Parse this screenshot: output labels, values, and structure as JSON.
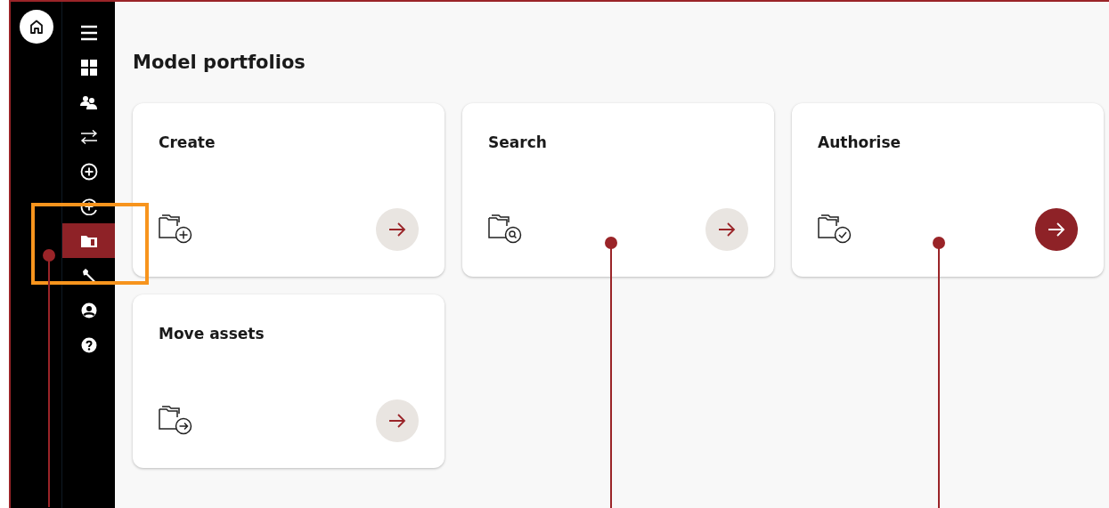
{
  "sidebar": {
    "home": {
      "selected": false
    },
    "items": [
      {
        "kind": "menu",
        "selected": false
      },
      {
        "kind": "dashboard",
        "selected": false
      },
      {
        "kind": "people",
        "selected": false
      },
      {
        "kind": "transfer",
        "selected": false
      },
      {
        "kind": "add",
        "selected": false
      },
      {
        "kind": "add-history",
        "selected": false
      },
      {
        "kind": "portfolio",
        "selected": true
      },
      {
        "kind": "wrench",
        "selected": false
      },
      {
        "kind": "account",
        "selected": false
      },
      {
        "kind": "help",
        "selected": false
      }
    ]
  },
  "page": {
    "title": "Model portfolios"
  },
  "cards": [
    {
      "title": "Create",
      "kind": "create",
      "highlighted": false
    },
    {
      "title": "Search",
      "kind": "search",
      "highlighted": false
    },
    {
      "title": "Authorise",
      "kind": "authorise",
      "highlighted": true
    },
    {
      "title": "Move assets",
      "kind": "move",
      "highlighted": false
    }
  ]
}
